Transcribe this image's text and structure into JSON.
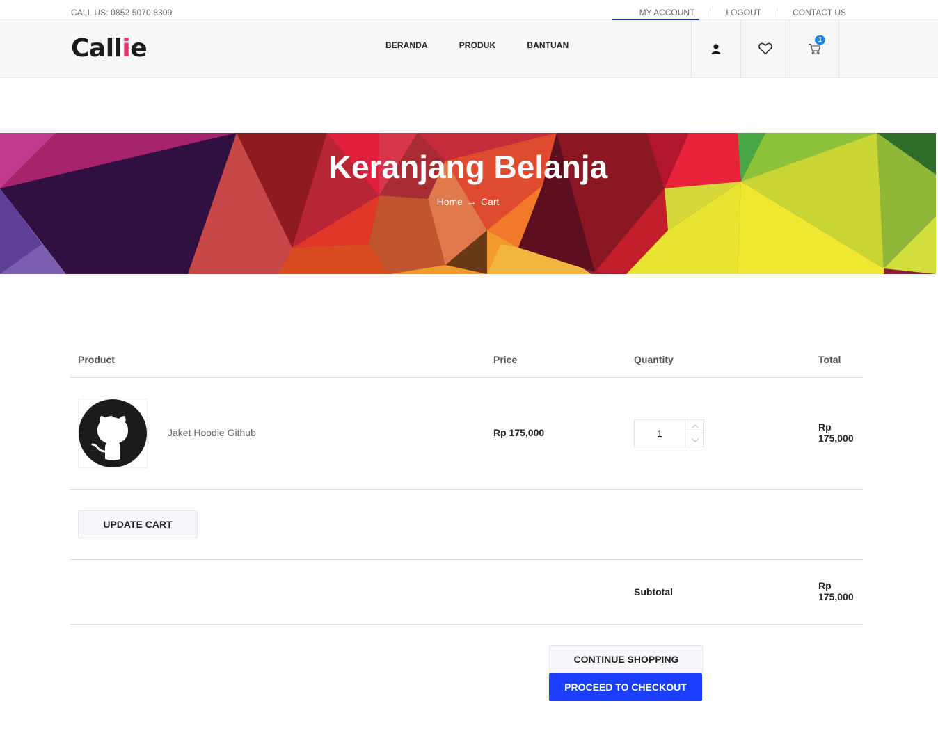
{
  "topbar": {
    "call": "CALL US: 0852 5070 8309",
    "links": [
      "MY ACCOUNT",
      "LOGOUT",
      "CONTACT US"
    ]
  },
  "header": {
    "logo_main": "Call",
    "logo_accent": "i",
    "logo_end": "e",
    "nav": [
      "BERANDA",
      "PRODUK",
      "BANTUAN"
    ],
    "cart_count": "1",
    "icons": [
      "user-icon",
      "heart-icon",
      "cart-icon"
    ]
  },
  "banner": {
    "title": "Keranjang Belanja",
    "breadcrumb_home": "Home",
    "breadcrumb_arrow": "→",
    "breadcrumb_current": "Cart"
  },
  "cart": {
    "headers": {
      "product": "Product",
      "price": "Price",
      "quantity": "Quantity",
      "total": "Total"
    },
    "items": [
      {
        "name": "Jaket Hoodie Github",
        "price": "Rp 175,000",
        "quantity": "1",
        "total_line1": "Rp",
        "total_line2": "175,000",
        "image_icon": "github-logo-icon"
      }
    ],
    "update_label": "UPDATE CART",
    "subtotal_label": "Subtotal",
    "subtotal_line1": "Rp",
    "subtotal_line2": "175,000",
    "continue_label": "CONTINUE SHOPPING",
    "checkout_label": "PROCEED TO CHECKOUT"
  },
  "colors": {
    "accent_pink": "#e8336d",
    "checkout_blue": "#1b3fff",
    "badge_blue": "#1e88e5"
  }
}
